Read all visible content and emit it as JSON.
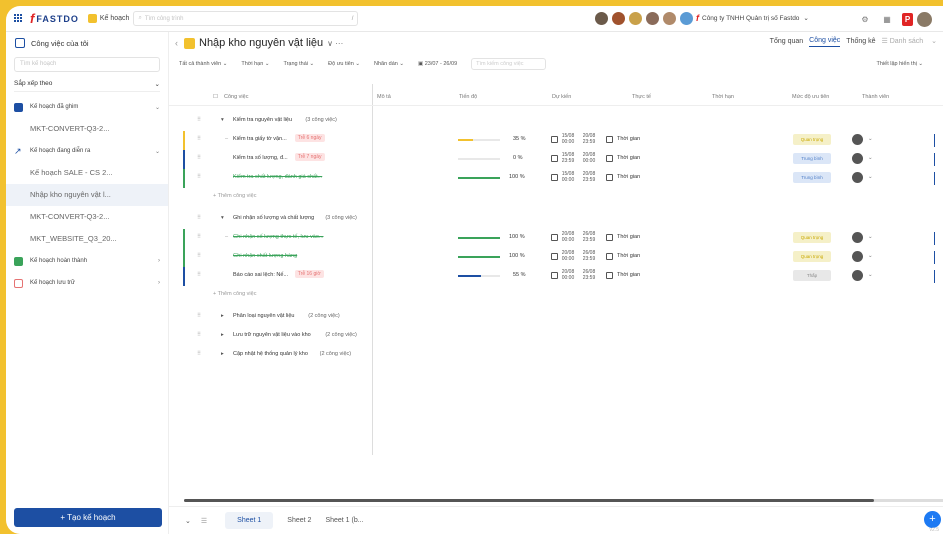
{
  "topbar": {
    "logo_text": "FASTDO",
    "app_name": "Kế hoạch",
    "search_placeholder": "Tìm công trình",
    "search_shortcut": "/",
    "company": "Công ty TNHH Quản trị số Fastdo",
    "company_chevron": "⌄"
  },
  "sidebar": {
    "header": "Công việc của tôi",
    "search_placeholder": "Tìm kế hoạch",
    "sort_label": "Sắp xếp theo",
    "groups": [
      {
        "label": "Kế hoạch đã ghim",
        "color": "#1d4fa3",
        "subs": [
          "MKT-CONVERT-Q3-2..."
        ]
      },
      {
        "label": "Kế hoạch đang diễn ra",
        "color": "#1d4fa3",
        "subs": [
          "Kế hoạch SALE - CS 2...",
          "Nhập kho nguyên vật l...",
          "MKT-CONVERT-Q3-2...",
          "MKT_WEBSITE_Q3_20..."
        ]
      },
      {
        "label": "Kế hoạch hoàn thành",
        "color": "#3aa35a",
        "subs": []
      },
      {
        "label": "Kế hoạch lưu trữ",
        "color": "#e57373",
        "subs": []
      }
    ],
    "create_button": "+ Tạo kế hoạch"
  },
  "main": {
    "title": "Nhập kho nguyên vật liệu",
    "title_more": "∨ ···",
    "views": [
      "Tổng quan",
      "Công việc",
      "Thống kê"
    ],
    "view_list": "Danh sách",
    "filters": [
      "Tất cả thành viên",
      "Thời hạn",
      "Trạng thái",
      "Độ ưu tiên",
      "Nhãn dán"
    ],
    "date_range": "23/07 - 26/09",
    "filter_search": "Tìm kiếm công việc",
    "settings": "Thiết lập hiển thị",
    "columns": [
      "Công việc",
      "Mô tả",
      "Tiến độ",
      "Dự kiến",
      "Thực tế",
      "Thời hạn",
      "Mức độ ưu tiên",
      "Thành viên"
    ],
    "add_task": "+ Thêm công việc",
    "time_label": "Thời gian",
    "groups": [
      {
        "name": "Kiểm tra nguyên vật liệu",
        "count": "(3 công việc)",
        "tasks": [
          {
            "name": "Kiểm tra giấy tờ vận...",
            "badge": "Trễ 6 ngày",
            "progress": 35,
            "progress_label": "35 %",
            "color": "#f2c12e",
            "start": "15/08 00:00",
            "end": "20/08 23:59",
            "priority": "Quan trọng",
            "pcolor": "#f5f0c8",
            "ptext": "#c9a800",
            "done": false
          },
          {
            "name": "Kiểm tra số lượng, đ...",
            "badge": "Trễ 7 ngày",
            "progress": 0,
            "progress_label": "0 %",
            "color": "#1d4fa3",
            "start": "15/08 23:59",
            "end": "20/08 00:00",
            "priority": "Trung bình",
            "pcolor": "#dbe6f7",
            "ptext": "#4f7fc8",
            "done": false
          },
          {
            "name": "Kiểm tra chất lượng, đánh giá chất...",
            "badge": "",
            "progress": 100,
            "progress_label": "100 %",
            "color": "#3aa35a",
            "start": "15/08 00:00",
            "end": "20/08 23:59",
            "priority": "Trung bình",
            "pcolor": "#dbe6f7",
            "ptext": "#4f7fc8",
            "done": true
          }
        ]
      },
      {
        "name": "Ghi nhận số lượng và chất lượng",
        "count": "(3 công việc)",
        "tasks": [
          {
            "name": "Ghi nhận số lượng thực tế, lưu vào...",
            "badge": "",
            "progress": 100,
            "progress_label": "100 %",
            "color": "#3aa35a",
            "start": "20/08 00:00",
            "end": "26/08 23:59",
            "priority": "Quan trọng",
            "pcolor": "#f5f0c8",
            "ptext": "#c9a800",
            "done": true
          },
          {
            "name": "Ghi nhận chất lượng hàng",
            "badge": "",
            "progress": 100,
            "progress_label": "100 %",
            "color": "#3aa35a",
            "start": "20/08 00:00",
            "end": "26/08 23:59",
            "priority": "Quan trọng",
            "pcolor": "#f5f0c8",
            "ptext": "#c9a800",
            "done": true
          },
          {
            "name": "Báo cáo sai lệch: Nế...",
            "badge": "Trễ 16 giờ",
            "progress": 55,
            "progress_label": "55 %",
            "color": "#1d4fa3",
            "start": "20/08 00:00",
            "end": "26/08 23:59",
            "priority": "Thấp",
            "pcolor": "#e8e8e8",
            "ptext": "#888",
            "done": false
          }
        ]
      }
    ],
    "collapsed_groups": [
      {
        "name": "Phân loại nguyên vật liệu",
        "count": "(2 công việc)"
      },
      {
        "name": "Lưu trữ nguyên vật liệu vào kho",
        "count": "(2 công việc)"
      },
      {
        "name": "Cập nhật hệ thống quản lý kho",
        "count": "(2 công việc)"
      }
    ]
  },
  "bottom": {
    "sheets": [
      "Sheet 1",
      "Sheet 2",
      "Sheet 1 (b..."
    ],
    "version": "v2.5"
  }
}
